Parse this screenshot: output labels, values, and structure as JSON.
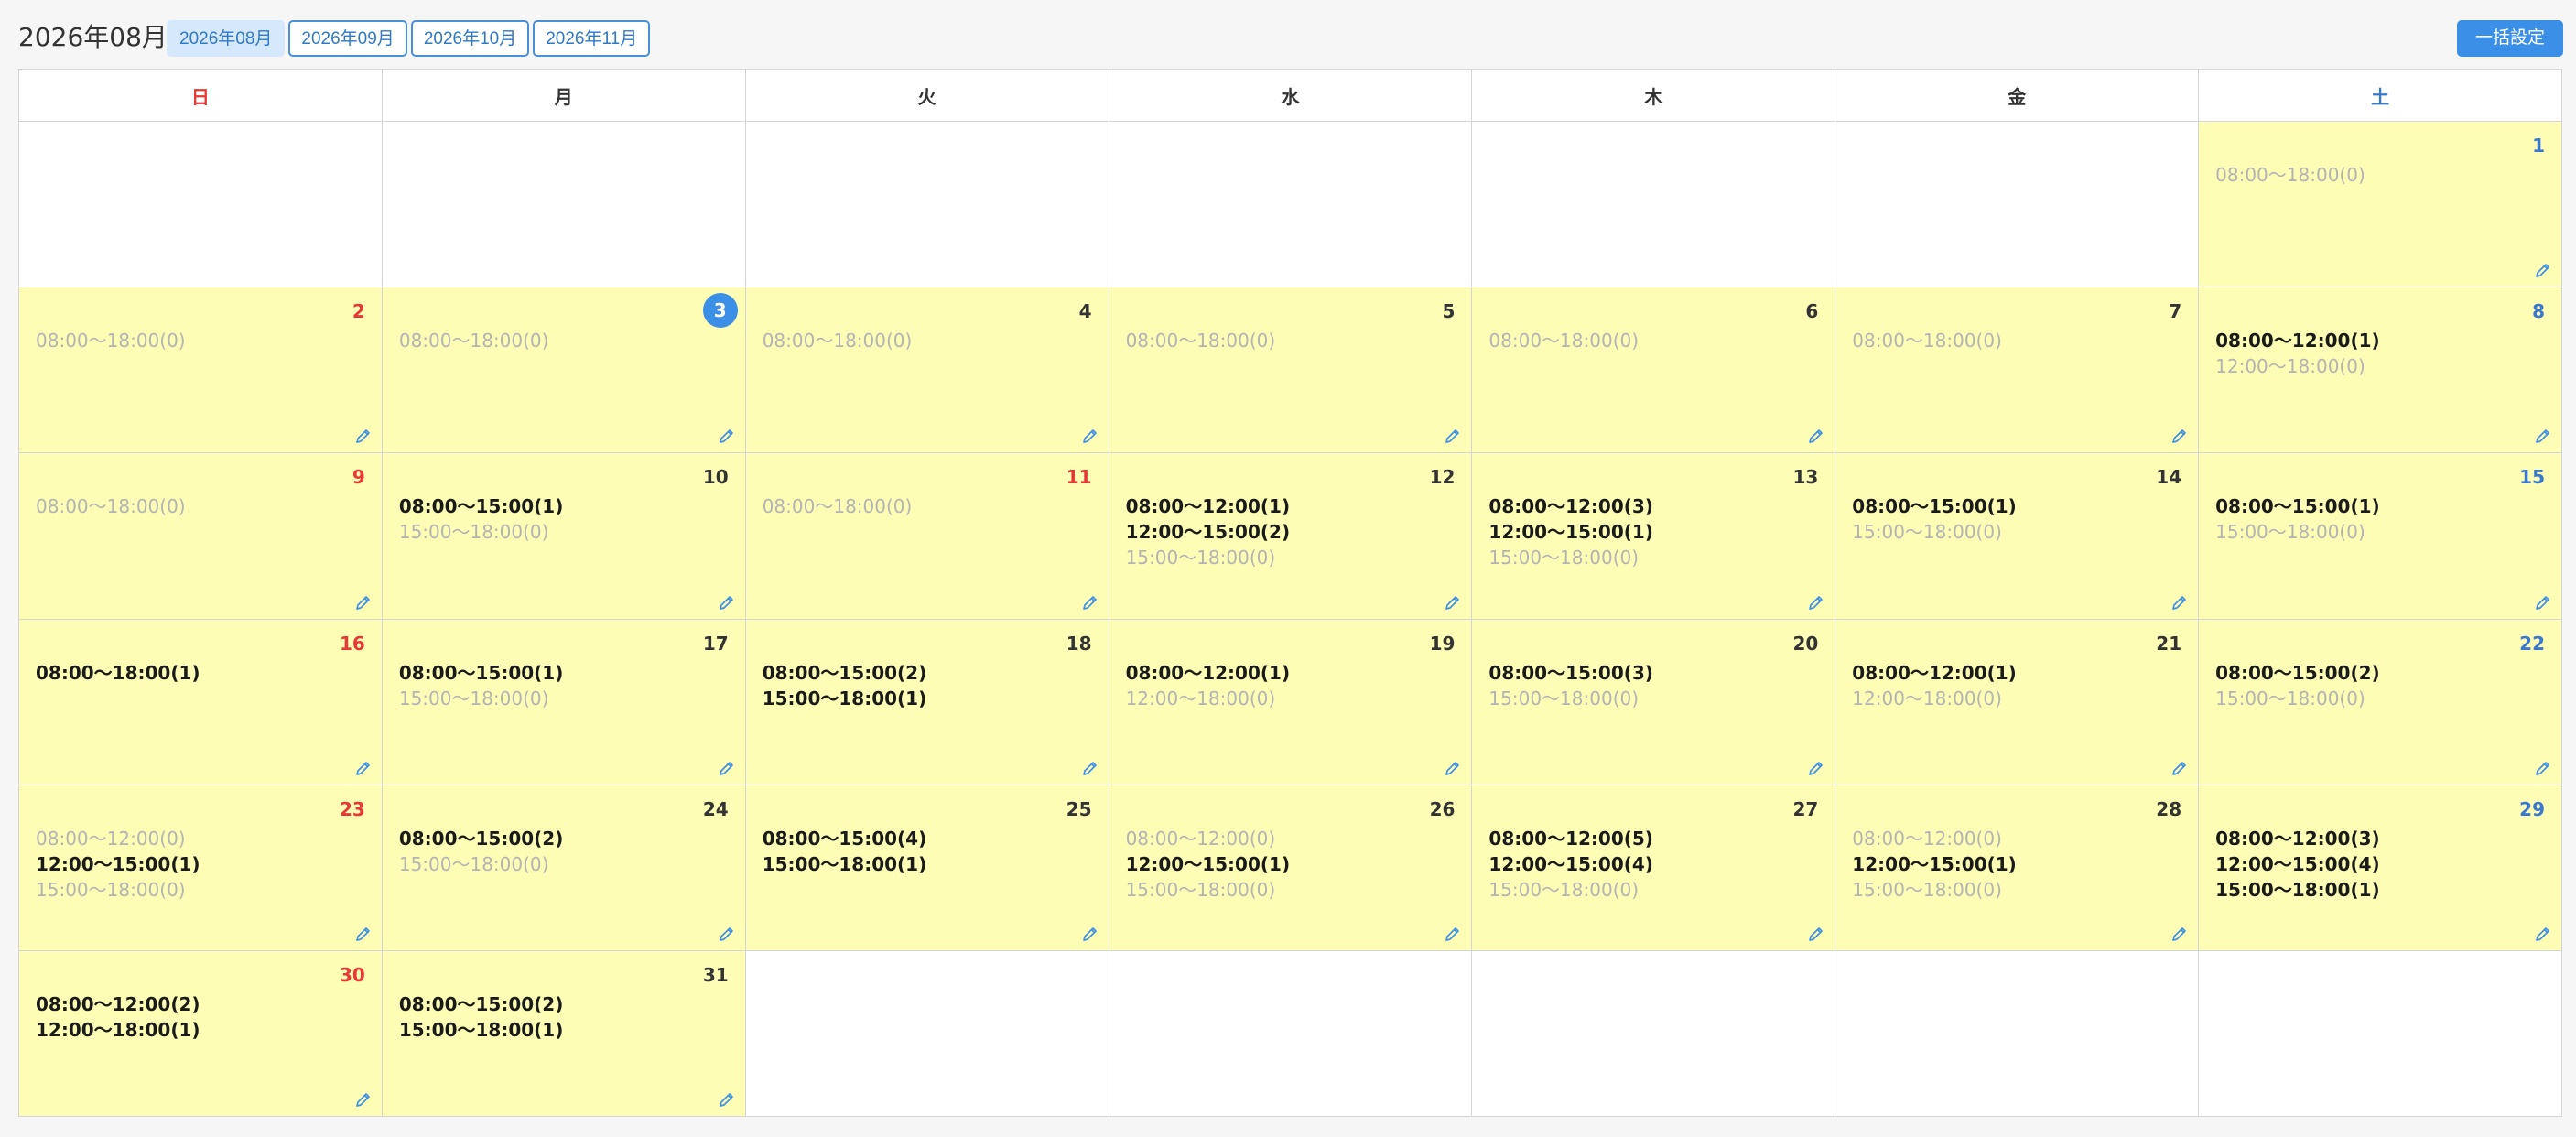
{
  "header": {
    "title": "2026年08月",
    "month_tabs": [
      {
        "label": "2026年08月",
        "active": true
      },
      {
        "label": "2026年09月",
        "active": false
      },
      {
        "label": "2026年10月",
        "active": false
      },
      {
        "label": "2026年11月",
        "active": false
      }
    ],
    "bulk_button": "一括設定"
  },
  "weekdays": [
    "日",
    "月",
    "火",
    "水",
    "木",
    "金",
    "土"
  ],
  "colors": {
    "accent": "#3b8fe6",
    "sunday": "#e53935",
    "saturday": "#3a78cf",
    "active_day_bg": "#fefdb5",
    "today_badge": "#3b8fe6"
  },
  "today": "3",
  "weeks": [
    [
      null,
      null,
      null,
      null,
      null,
      null,
      {
        "day": "1",
        "slots": [
          {
            "text": "08:00〜18:00(0)",
            "booked": false
          }
        ]
      }
    ],
    [
      {
        "day": "2",
        "slots": [
          {
            "text": "08:00〜18:00(0)",
            "booked": false
          }
        ]
      },
      {
        "day": "3",
        "slots": [
          {
            "text": "08:00〜18:00(0)",
            "booked": false
          }
        ]
      },
      {
        "day": "4",
        "slots": [
          {
            "text": "08:00〜18:00(0)",
            "booked": false
          }
        ]
      },
      {
        "day": "5",
        "slots": [
          {
            "text": "08:00〜18:00(0)",
            "booked": false
          }
        ]
      },
      {
        "day": "6",
        "slots": [
          {
            "text": "08:00〜18:00(0)",
            "booked": false
          }
        ]
      },
      {
        "day": "7",
        "slots": [
          {
            "text": "08:00〜18:00(0)",
            "booked": false
          }
        ]
      },
      {
        "day": "8",
        "slots": [
          {
            "text": "08:00〜12:00(1)",
            "booked": true
          },
          {
            "text": "12:00〜18:00(0)",
            "booked": false
          }
        ]
      }
    ],
    [
      {
        "day": "9",
        "slots": [
          {
            "text": "08:00〜18:00(0)",
            "booked": false
          }
        ]
      },
      {
        "day": "10",
        "slots": [
          {
            "text": "08:00〜15:00(1)",
            "booked": true
          },
          {
            "text": "15:00〜18:00(0)",
            "booked": false
          }
        ]
      },
      {
        "day": "11",
        "holiday": true,
        "slots": [
          {
            "text": "08:00〜18:00(0)",
            "booked": false
          }
        ]
      },
      {
        "day": "12",
        "slots": [
          {
            "text": "08:00〜12:00(1)",
            "booked": true
          },
          {
            "text": "12:00〜15:00(2)",
            "booked": true
          },
          {
            "text": "15:00〜18:00(0)",
            "booked": false
          }
        ]
      },
      {
        "day": "13",
        "slots": [
          {
            "text": "08:00〜12:00(3)",
            "booked": true
          },
          {
            "text": "12:00〜15:00(1)",
            "booked": true
          },
          {
            "text": "15:00〜18:00(0)",
            "booked": false
          }
        ]
      },
      {
        "day": "14",
        "slots": [
          {
            "text": "08:00〜15:00(1)",
            "booked": true
          },
          {
            "text": "15:00〜18:00(0)",
            "booked": false
          }
        ]
      },
      {
        "day": "15",
        "slots": [
          {
            "text": "08:00〜15:00(1)",
            "booked": true
          },
          {
            "text": "15:00〜18:00(0)",
            "booked": false
          }
        ]
      }
    ],
    [
      {
        "day": "16",
        "slots": [
          {
            "text": "08:00〜18:00(1)",
            "booked": true
          }
        ]
      },
      {
        "day": "17",
        "slots": [
          {
            "text": "08:00〜15:00(1)",
            "booked": true
          },
          {
            "text": "15:00〜18:00(0)",
            "booked": false
          }
        ]
      },
      {
        "day": "18",
        "slots": [
          {
            "text": "08:00〜15:00(2)",
            "booked": true
          },
          {
            "text": "15:00〜18:00(1)",
            "booked": true
          }
        ]
      },
      {
        "day": "19",
        "slots": [
          {
            "text": "08:00〜12:00(1)",
            "booked": true
          },
          {
            "text": "12:00〜18:00(0)",
            "booked": false
          }
        ]
      },
      {
        "day": "20",
        "slots": [
          {
            "text": "08:00〜15:00(3)",
            "booked": true
          },
          {
            "text": "15:00〜18:00(0)",
            "booked": false
          }
        ]
      },
      {
        "day": "21",
        "slots": [
          {
            "text": "08:00〜12:00(1)",
            "booked": true
          },
          {
            "text": "12:00〜18:00(0)",
            "booked": false
          }
        ]
      },
      {
        "day": "22",
        "slots": [
          {
            "text": "08:00〜15:00(2)",
            "booked": true
          },
          {
            "text": "15:00〜18:00(0)",
            "booked": false
          }
        ]
      }
    ],
    [
      {
        "day": "23",
        "slots": [
          {
            "text": "08:00〜12:00(0)",
            "booked": false
          },
          {
            "text": "12:00〜15:00(1)",
            "booked": true
          },
          {
            "text": "15:00〜18:00(0)",
            "booked": false
          }
        ]
      },
      {
        "day": "24",
        "slots": [
          {
            "text": "08:00〜15:00(2)",
            "booked": true
          },
          {
            "text": "15:00〜18:00(0)",
            "booked": false
          }
        ]
      },
      {
        "day": "25",
        "slots": [
          {
            "text": "08:00〜15:00(4)",
            "booked": true
          },
          {
            "text": "15:00〜18:00(1)",
            "booked": true
          }
        ]
      },
      {
        "day": "26",
        "slots": [
          {
            "text": "08:00〜12:00(0)",
            "booked": false
          },
          {
            "text": "12:00〜15:00(1)",
            "booked": true
          },
          {
            "text": "15:00〜18:00(0)",
            "booked": false
          }
        ]
      },
      {
        "day": "27",
        "slots": [
          {
            "text": "08:00〜12:00(5)",
            "booked": true
          },
          {
            "text": "12:00〜15:00(4)",
            "booked": true
          },
          {
            "text": "15:00〜18:00(0)",
            "booked": false
          }
        ]
      },
      {
        "day": "28",
        "slots": [
          {
            "text": "08:00〜12:00(0)",
            "booked": false
          },
          {
            "text": "12:00〜15:00(1)",
            "booked": true
          },
          {
            "text": "15:00〜18:00(0)",
            "booked": false
          }
        ]
      },
      {
        "day": "29",
        "slots": [
          {
            "text": "08:00〜12:00(3)",
            "booked": true
          },
          {
            "text": "12:00〜15:00(4)",
            "booked": true
          },
          {
            "text": "15:00〜18:00(1)",
            "booked": true
          }
        ]
      }
    ],
    [
      {
        "day": "30",
        "slots": [
          {
            "text": "08:00〜12:00(2)",
            "booked": true
          },
          {
            "text": "12:00〜18:00(1)",
            "booked": true
          }
        ]
      },
      {
        "day": "31",
        "slots": [
          {
            "text": "08:00〜15:00(2)",
            "booked": true
          },
          {
            "text": "15:00〜18:00(1)",
            "booked": true
          }
        ]
      },
      null,
      null,
      null,
      null,
      null
    ]
  ]
}
